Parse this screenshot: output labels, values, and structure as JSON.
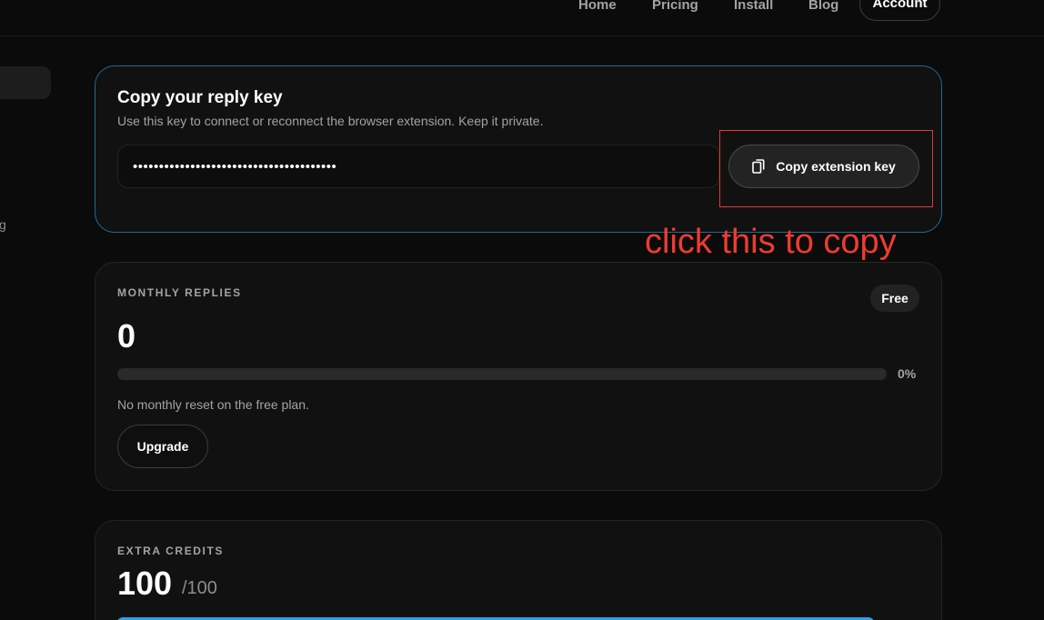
{
  "nav": {
    "links": [
      "Home",
      "Pricing",
      "Install",
      "Blog"
    ],
    "account_label": "Account"
  },
  "sidebar": {
    "fragment_text": "g"
  },
  "key_card": {
    "title": "Copy your reply key",
    "subtitle": "Use this key to connect or reconnect the browser extension. Keep it private.",
    "masked_value": "•••••••••••••••••••••••••••••••••••••••",
    "copy_button_label": "Copy extension key",
    "copy_icon": "copy-icon"
  },
  "annotation": {
    "text": "click this to copy",
    "color": "#ef3b32"
  },
  "monthly": {
    "section_label": "MONTHLY REPLIES",
    "plan_badge": "Free",
    "count": "0",
    "progress_percent": 0,
    "progress_label": "0%",
    "note": "No monthly reset on the free plan.",
    "upgrade_label": "Upgrade"
  },
  "credits": {
    "section_label": "EXTRA CREDITS",
    "count": "100",
    "total": "/100",
    "progress_fraction": 1.0
  },
  "colors": {
    "background": "#0b0b0b",
    "card": "#111111",
    "accent_blue": "#2da1e6",
    "key_card_border": "#1f6a96",
    "highlight_red": "#e53935"
  }
}
